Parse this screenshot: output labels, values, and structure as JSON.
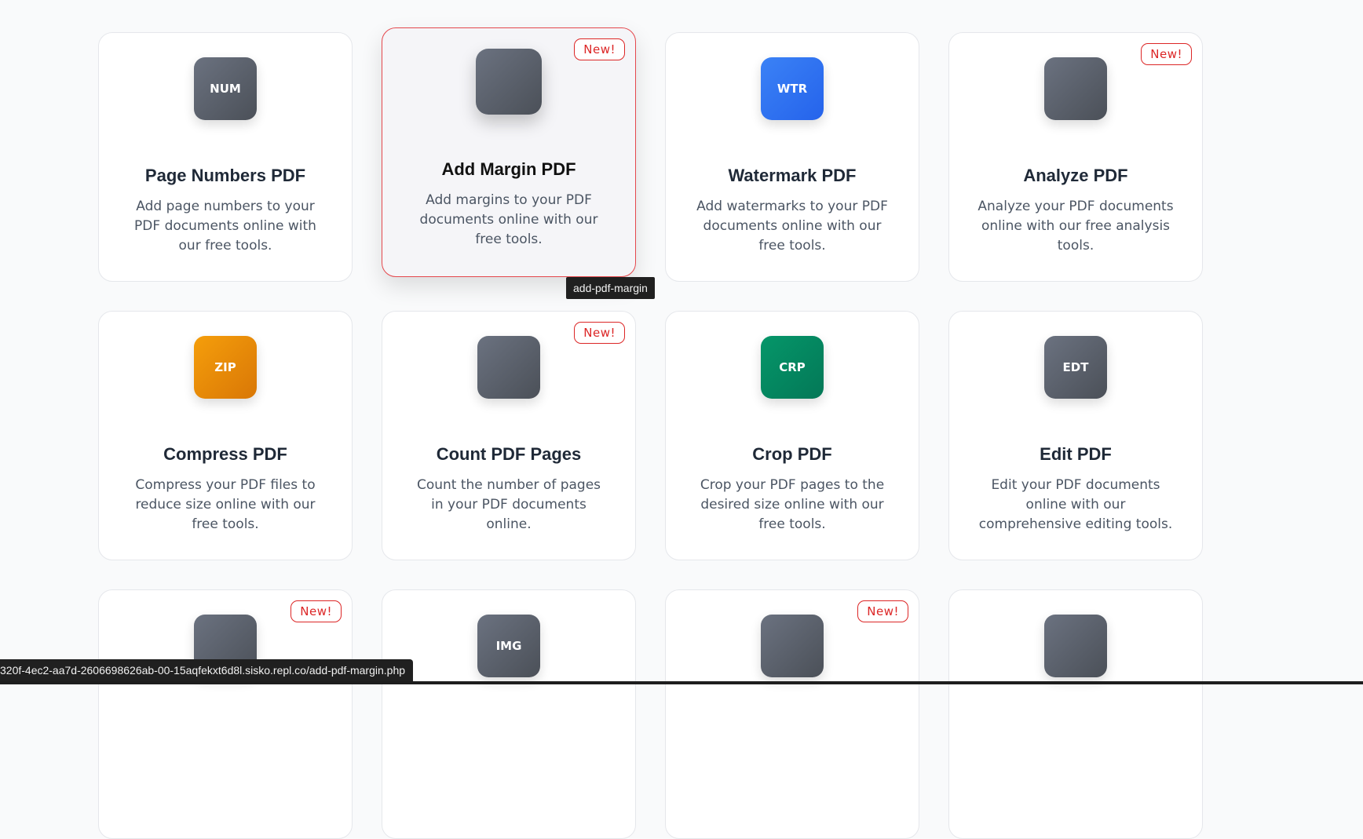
{
  "colors": {
    "gray_icon": "#555b64",
    "blue_icon": "#2f6df4",
    "orange_icon": "#e8860c",
    "green_icon": "#0d8a5f",
    "badge_red": "#dc2626",
    "hover_border": "#e5484d"
  },
  "tools": [
    {
      "icon_label": "NUM",
      "icon_color": "gray",
      "title": "Page Numbers PDF",
      "description": "Add page numbers to your PDF documents online with our free tools.",
      "badge": ""
    },
    {
      "icon_label": "",
      "icon_color": "gray",
      "title": "Add Margin PDF",
      "description": "Add margins to your PDF documents online with our free tools.",
      "badge": "New!",
      "hovered": true
    },
    {
      "icon_label": "WTR",
      "icon_color": "blue",
      "title": "Watermark PDF",
      "description": "Add watermarks to your PDF documents online with our free tools.",
      "badge": ""
    },
    {
      "icon_label": "",
      "icon_color": "gray",
      "title": "Analyze PDF",
      "description": "Analyze your PDF documents online with our free analysis tools.",
      "badge": "New!"
    },
    {
      "icon_label": "ZIP",
      "icon_color": "orange",
      "title": "Compress PDF",
      "description": "Compress your PDF files to reduce size online with our free tools.",
      "badge": ""
    },
    {
      "icon_label": "",
      "icon_color": "gray",
      "title": "Count PDF Pages",
      "description": "Count the number of pages in your PDF documents online.",
      "badge": "New!"
    },
    {
      "icon_label": "CRP",
      "icon_color": "green",
      "title": "Crop PDF",
      "description": "Crop your PDF pages to the desired size online with our free tools.",
      "badge": ""
    },
    {
      "icon_label": "EDT",
      "icon_color": "gray",
      "title": "Edit PDF",
      "description": "Edit your PDF documents online with our comprehensive editing tools.",
      "badge": ""
    },
    {
      "icon_label": "",
      "icon_color": "gray",
      "title": "",
      "description": "",
      "badge": "New!"
    },
    {
      "icon_label": "IMG",
      "icon_color": "gray",
      "title": "",
      "description": "",
      "badge": ""
    },
    {
      "icon_label": "",
      "icon_color": "gray",
      "title": "",
      "description": "",
      "badge": "New!"
    },
    {
      "icon_label": "",
      "icon_color": "gray",
      "title": "",
      "description": "",
      "badge": ""
    }
  ],
  "tooltip": "add-pdf-margin",
  "status_url": "320f-4ec2-aa7d-2606698626ab-00-15aqfekxt6d8l.sisko.repl.co/add-pdf-margin.php"
}
